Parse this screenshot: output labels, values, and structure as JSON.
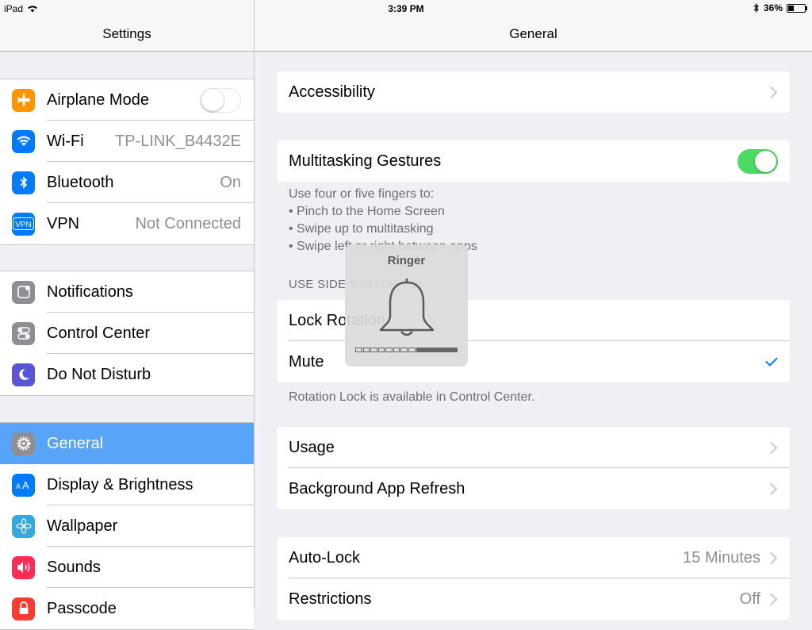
{
  "status": {
    "device": "iPad",
    "time": "3:39 PM",
    "battery": "36%",
    "battery_level": 0.36
  },
  "sidebar": {
    "title": "Settings",
    "groups": [
      [
        {
          "label": "Airplane Mode",
          "icon": "airplane-icon",
          "color": "#ff9500",
          "switch": "off"
        },
        {
          "label": "Wi-Fi",
          "icon": "wifi-icon",
          "color": "#007aff",
          "value": "TP-LINK_B4432E"
        },
        {
          "label": "Bluetooth",
          "icon": "bluetooth-icon",
          "color": "#007aff",
          "value": "On"
        },
        {
          "label": "VPN",
          "icon": "vpn-icon",
          "color": "#007aff",
          "value": "Not Connected"
        }
      ],
      [
        {
          "label": "Notifications",
          "icon": "notifications-icon",
          "color": "#8e8e93"
        },
        {
          "label": "Control Center",
          "icon": "control-center-icon",
          "color": "#8e8e93"
        },
        {
          "label": "Do Not Disturb",
          "icon": "moon-icon",
          "color": "#5856d6"
        }
      ],
      [
        {
          "label": "General",
          "icon": "gear-icon",
          "color": "#8e8e93",
          "selected": true
        },
        {
          "label": "Display & Brightness",
          "icon": "display-brightness-icon",
          "color": "#007aff"
        },
        {
          "label": "Wallpaper",
          "icon": "wallpaper-icon",
          "color": "#34aadc"
        },
        {
          "label": "Sounds",
          "icon": "speaker-icon",
          "color": "#ff2d55"
        },
        {
          "label": "Passcode",
          "icon": "lock-icon",
          "color": "#ff3b30"
        }
      ]
    ]
  },
  "detail": {
    "title": "General",
    "accessibility": "Accessibility",
    "multitasking": {
      "label": "Multitasking Gestures",
      "switch": "on"
    },
    "multitasking_note": [
      "Use four or five fingers to:",
      "• Pinch to the Home Screen",
      "• Swipe up to multitasking",
      "• Swipe left or right between apps"
    ],
    "side_switch_header": "USE SIDE SWITCH TO:",
    "side_switch": [
      {
        "label": "Lock Rotation",
        "checked": false
      },
      {
        "label": "Mute",
        "checked": true
      }
    ],
    "rotation_note": "Rotation Lock is available in Control Center.",
    "usage_group": [
      "Usage",
      "Background App Refresh"
    ],
    "lock_group": [
      {
        "label": "Auto-Lock",
        "value": "15 Minutes"
      },
      {
        "label": "Restrictions",
        "value": "Off"
      }
    ]
  },
  "hud": {
    "title": "Ringer",
    "level": 0.5
  }
}
